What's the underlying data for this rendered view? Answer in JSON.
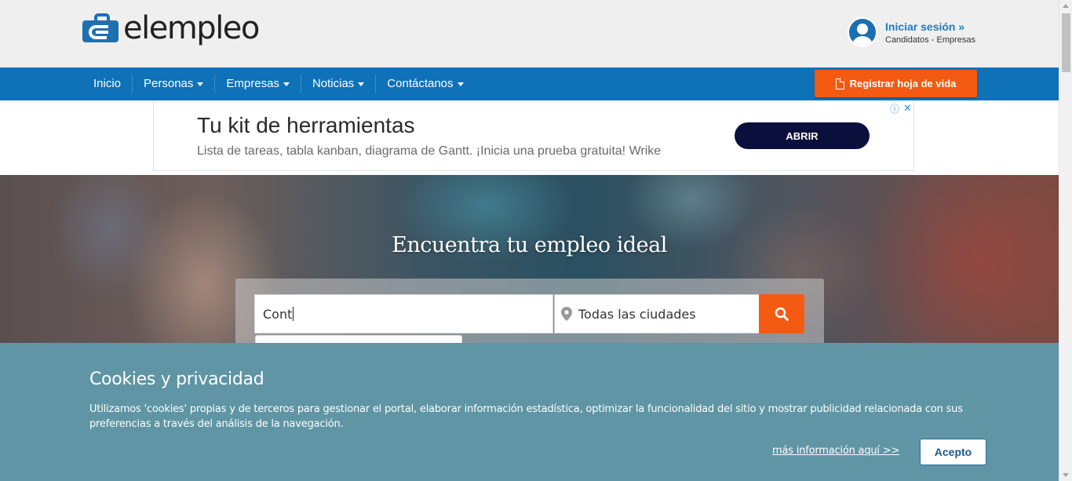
{
  "header": {
    "logo_text": "elempleo",
    "login_title": "Iniciar sesión »",
    "login_subtitle": "Candidatos - Empresas"
  },
  "nav": {
    "items": [
      {
        "label": "Inicio",
        "dropdown": false
      },
      {
        "label": "Personas",
        "dropdown": true
      },
      {
        "label": "Empresas",
        "dropdown": true
      },
      {
        "label": "Noticias",
        "dropdown": true
      },
      {
        "label": "Contáctanos",
        "dropdown": true
      }
    ],
    "cv_button": "Registrar hoja de vida"
  },
  "ad": {
    "title": "Tu kit de herramientas",
    "description": "Lista de tareas, tabla kanban, diagrama de Gantt. ¡Inicia una prueba gratuita! Wrike",
    "cta": "ABRIR",
    "info_icon": "ⓘ",
    "close_icon": "✕"
  },
  "hero": {
    "title": "Encuentra tu empleo ideal",
    "search_value": "Cont",
    "city_value": "Todas las ciudades"
  },
  "cookies": {
    "title": "Cookies y privacidad",
    "text": "Utilizamos 'cookies' propias y de terceros para gestionar el portal, elaborar información estadística, optimizar la funcionalidad del sitio y mostrar publicidad relacionada con sus preferencias a través del análisis de la navegación.",
    "more_link": "más información aquí >>",
    "accept_button": "Acepto"
  },
  "colors": {
    "nav_blue": "#0f72b8",
    "orange": "#f55a12",
    "cookie_bg": "#5f95a4",
    "ad_button": "#0b0f3b"
  }
}
